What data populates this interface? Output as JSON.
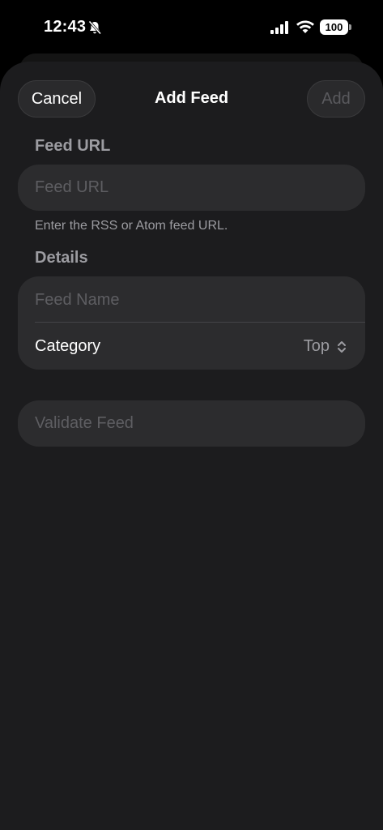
{
  "status_bar": {
    "time": "12:43",
    "battery": "100",
    "icons": [
      "bell-slash-icon",
      "cellular-signal-icon",
      "wifi-icon",
      "battery-icon"
    ]
  },
  "sheet": {
    "title": "Add Feed",
    "cancel_label": "Cancel",
    "add_label": "Add"
  },
  "feed_url_section": {
    "label": "Feed URL",
    "placeholder": "Feed URL",
    "helper": "Enter the RSS or Atom feed URL."
  },
  "details_section": {
    "label": "Details",
    "name_placeholder": "Feed Name",
    "category_label": "Category",
    "category_value": "Top"
  },
  "validate": {
    "label": "Validate Feed"
  },
  "colors": {
    "sheet_bg": "#1c1c1e",
    "field_bg": "#2c2c2e",
    "secondary_text": "#9c9ca1",
    "placeholder_text": "#5e5e62"
  }
}
